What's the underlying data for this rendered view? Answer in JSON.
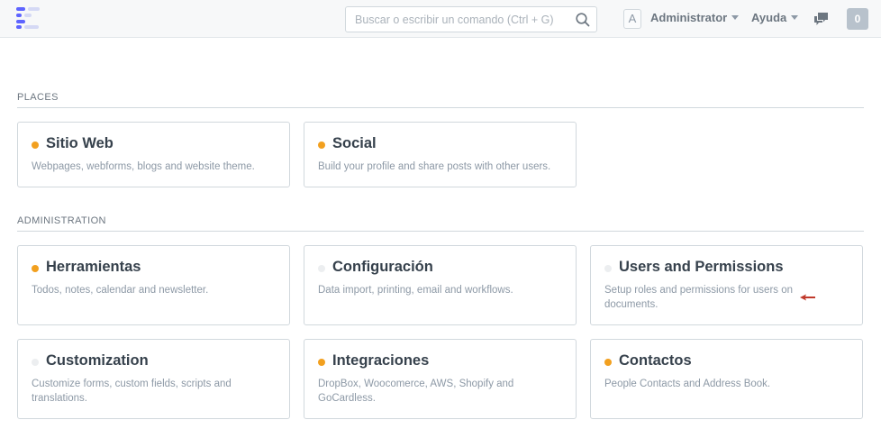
{
  "navbar": {
    "search_placeholder": "Buscar o escribir un comando (Ctrl + G)",
    "avatar_letter": "A",
    "user_label": "Administrator",
    "help_label": "Ayuda",
    "notification_count": "0",
    "icons": [
      "app-logo-icon",
      "search-icon",
      "chevron-down-icon",
      "chat-icon"
    ]
  },
  "colors": {
    "dot_active": "#f2a01f",
    "dot_inactive": "#eceef0",
    "logo_primary": "#5e64ff",
    "logo_secondary": "#d5d9f5"
  },
  "sections": {
    "places": {
      "label": "PLACES",
      "cards": [
        {
          "title": "Sitio Web",
          "desc": "Webpages, webforms, blogs and website theme.",
          "active": true
        },
        {
          "title": "Social",
          "desc": "Build your profile and share posts with other users.",
          "active": true
        }
      ]
    },
    "administration": {
      "label": "ADMINISTRATION",
      "cards": [
        {
          "title": "Herramientas",
          "desc": "Todos, notes, calendar and newsletter.",
          "active": true
        },
        {
          "title": "Configuración",
          "desc": "Data import, printing, email and workflows.",
          "active": false
        },
        {
          "title": "Users and Permissions",
          "desc": "Setup roles and permissions for users on documents.",
          "active": false
        },
        {
          "title": "Customization",
          "desc": "Customize forms, custom fields, scripts and translations.",
          "active": false
        },
        {
          "title": "Integraciones",
          "desc": "DropBox, Woocomerce, AWS, Shopify and GoCardless.",
          "active": true
        },
        {
          "title": "Contactos",
          "desc": "People Contacts and Address Book.",
          "active": true
        }
      ]
    }
  }
}
